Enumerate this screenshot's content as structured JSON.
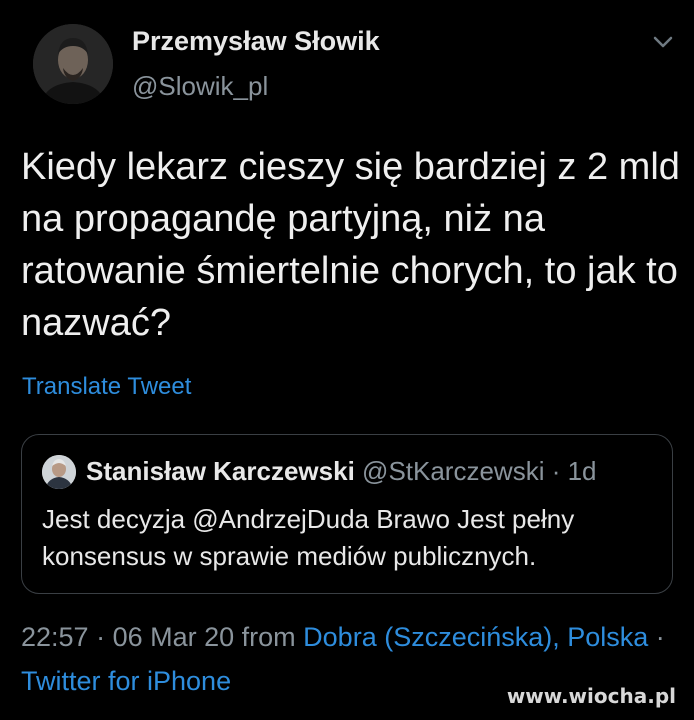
{
  "tweet": {
    "author": {
      "name": "Przemysław Słowik",
      "handle": "@Slowik_pl"
    },
    "text": "Kiedy lekarz cieszy się bardziej z 2 mld na propagandę partyjną, niż na ratowanie śmiertelnie chorych, to jak to nazwać?",
    "translate_label": "Translate Tweet",
    "menu_icon": "chevron-down-icon",
    "quoted": {
      "name": "Stanisław Karczewski",
      "handle": "@StKarczewski",
      "separator": " · ",
      "age": "1d",
      "text": "Jest decyzja @AndrzejDuda Brawo Jest pełny konsensus w sprawie mediów publicznych."
    },
    "meta": {
      "time": "22:57",
      "sep1": " · ",
      "date": "06 Mar 20",
      "from_label": " from ",
      "location": "Dobra (Szczecińska), Polska",
      "sep2": " · ",
      "source": "Twitter for iPhone"
    }
  },
  "watermark": "www.wiocha.pl",
  "colors": {
    "background": "#000000",
    "link": "#2e8ddd",
    "muted": "#8a949c",
    "text": "#efefef",
    "border": "#3a3f44"
  }
}
